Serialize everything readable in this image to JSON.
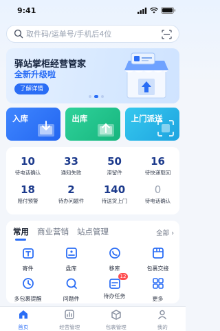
{
  "status_bar": {
    "time": "9:41"
  },
  "search": {
    "placeholder": "取件码/运单号/手机后4位"
  },
  "banner": {
    "title": "驿站掌柜经营管家",
    "subtitle": "全新升级啦",
    "button": "了解详情",
    "slides": 3,
    "active_slide": 1
  },
  "quick_actions": [
    {
      "label": "入库",
      "icon": "inbound-box-icon"
    },
    {
      "label": "出库",
      "icon": "outbound-box-icon"
    },
    {
      "label": "上门派送",
      "icon": "scan-delivery-icon"
    }
  ],
  "stats": [
    {
      "value": "10",
      "label": "待电话确认"
    },
    {
      "value": "33",
      "label": "通知失败"
    },
    {
      "value": "50",
      "label": "滞留件"
    },
    {
      "value": "16",
      "label": "待快递取回"
    },
    {
      "value": "18",
      "label": "赔付预警"
    },
    {
      "value": "2",
      "label": "待办问题件"
    },
    {
      "value": "140",
      "label": "待送货上门"
    },
    {
      "value": "0",
      "label": "待电话确认"
    }
  ],
  "panel": {
    "tabs": [
      "常用",
      "商业营销",
      "站点管理"
    ],
    "active_tab": 0,
    "all_label": "全部",
    "items": [
      {
        "label": "寄件",
        "icon": "send-package-icon"
      },
      {
        "label": "盘库",
        "icon": "inventory-icon"
      },
      {
        "label": "移库",
        "icon": "move-stock-icon"
      },
      {
        "label": "包裹交接",
        "icon": "package-handover-icon"
      },
      {
        "label": "多包裹提醒",
        "icon": "multi-package-icon"
      },
      {
        "label": "问题件",
        "icon": "problem-package-icon"
      },
      {
        "label": "待办任务",
        "icon": "todo-task-icon",
        "badge": "12"
      },
      {
        "label": "更多",
        "icon": "more-icon"
      }
    ]
  },
  "tabbar": [
    {
      "label": "首页",
      "icon": "home-icon",
      "active": true
    },
    {
      "label": "经营管理",
      "icon": "business-icon",
      "active": false
    },
    {
      "label": "包裹管理",
      "icon": "package-icon",
      "active": false
    },
    {
      "label": "我的",
      "icon": "profile-icon",
      "active": false
    }
  ],
  "colors": {
    "accent": "#2a6df5",
    "green": "#17b57e",
    "cyan": "#1ea4e0",
    "stat_number": "#1c3a8c"
  }
}
